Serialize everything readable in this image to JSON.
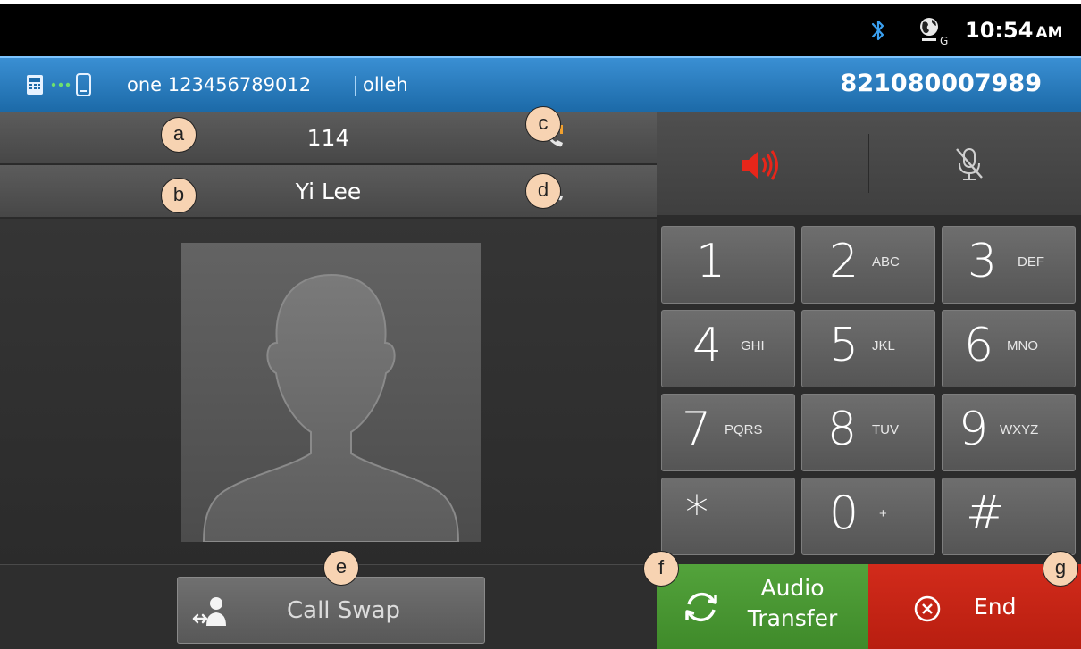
{
  "status_bar": {
    "time": "10:54",
    "ampm": "AM",
    "icons": [
      "bluetooth-icon",
      "globe-network-icon"
    ]
  },
  "info_bar": {
    "device_text": "one 123456789012",
    "carrier": "olleh",
    "own_number": "821080007989"
  },
  "calls": [
    {
      "label": "114",
      "state_icon": "call-on-hold-icon"
    },
    {
      "label": "Yi Lee",
      "state_icon": "active-call-icon"
    }
  ],
  "audio_controls": {
    "speaker": "speaker-icon",
    "mute": "mute-microphone-icon",
    "speaker_color": "#e8261a"
  },
  "keypad": [
    {
      "digit": "1",
      "letters": ""
    },
    {
      "digit": "2",
      "letters": "ABC"
    },
    {
      "digit": "3",
      "letters": "DEF"
    },
    {
      "digit": "4",
      "letters": "GHI"
    },
    {
      "digit": "5",
      "letters": "JKL"
    },
    {
      "digit": "6",
      "letters": "MNO"
    },
    {
      "digit": "7",
      "letters": "PQRS"
    },
    {
      "digit": "8",
      "letters": "TUV"
    },
    {
      "digit": "9",
      "letters": "WXYZ"
    },
    {
      "digit": "*",
      "letters": ""
    },
    {
      "digit": "0",
      "letters": "+"
    },
    {
      "digit": "#",
      "letters": ""
    }
  ],
  "buttons": {
    "call_swap": "Call Swap",
    "audio_transfer_line1": "Audio",
    "audio_transfer_line2": "Transfer",
    "end": "End"
  },
  "markers": [
    "a",
    "b",
    "c",
    "d",
    "e",
    "f",
    "g"
  ],
  "colors": {
    "info_bar": "#2a7cc0",
    "transfer": "#4a9a33",
    "end": "#c8251a",
    "marker_fill": "#f7d3b2"
  }
}
